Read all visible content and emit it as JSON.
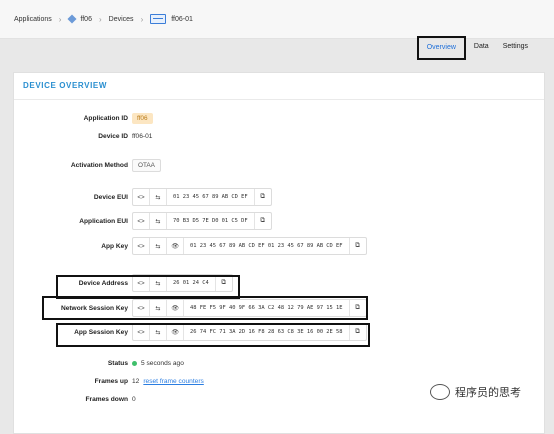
{
  "breadcrumb": {
    "applications": "Applications",
    "app": "ff06",
    "devices": "Devices",
    "device": "ff06-01"
  },
  "tabs": [
    "Overview",
    "Data",
    "Settings"
  ],
  "active_tab": "Overview",
  "card_title": "DEVICE OVERVIEW",
  "fields": {
    "application_id_label": "Application ID",
    "application_id": "ff06",
    "device_id_label": "Device ID",
    "device_id": "ff06-01",
    "activation_label": "Activation Method",
    "activation": "OTAA",
    "dev_eui_label": "Device EUI",
    "dev_eui": "01 23 45 67 89 AB CD EF",
    "app_eui_label": "Application EUI",
    "app_eui": "70 B3 D5 7E D0 01 C5 DF",
    "app_key_label": "App Key",
    "app_key": "01 23 45 67 89 AB CD EF 01 23 45 67 89 AB CD EF",
    "dev_addr_label": "Device Address",
    "dev_addr": "26 01 24 C4",
    "nwk_skey_label": "Network Session Key",
    "nwk_skey": "48 FE F5 9F 40 9F 66 3A C2 48 12 79 AE 97 15 1E",
    "app_skey_label": "App Session Key",
    "app_skey": "26 74 FC 71 3A 2D 16 F8 28 63 C8 3E 16 00 2E 58",
    "status_label": "Status",
    "status": "5 seconds ago",
    "frames_up_label": "Frames up",
    "frames_up": "12",
    "reset_link": "reset frame counters",
    "frames_down_label": "Frames down",
    "frames_down": "0"
  },
  "button_glyphs": {
    "toggle": "<>",
    "swap": "⇆",
    "eye": "👁",
    "copy": "⧉"
  },
  "watermark": "程序员的思考",
  "colors": {
    "accent": "#2a8fd0",
    "link": "#2a7de1",
    "badge_bg": "#fce6c2",
    "status": "#3fbf6b"
  }
}
